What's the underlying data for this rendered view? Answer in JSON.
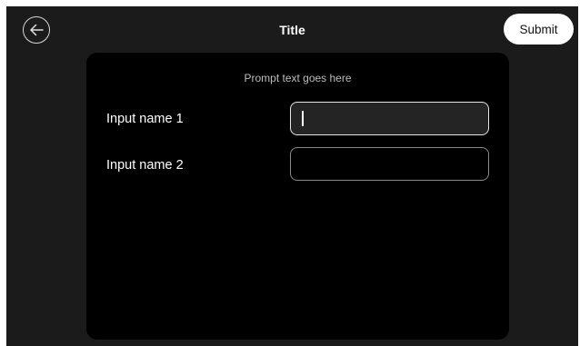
{
  "header": {
    "back_icon": "arrow-left-icon",
    "title": "Title",
    "submit_label": "Submit"
  },
  "form": {
    "prompt": "Prompt text goes here",
    "fields": [
      {
        "label": "Input name 1",
        "value": "",
        "focused": true
      },
      {
        "label": "Input name 2",
        "value": "",
        "focused": false
      }
    ]
  },
  "colors": {
    "background": "#1b1b1b",
    "panel": "#000000",
    "accent_button": "#ffffff"
  }
}
